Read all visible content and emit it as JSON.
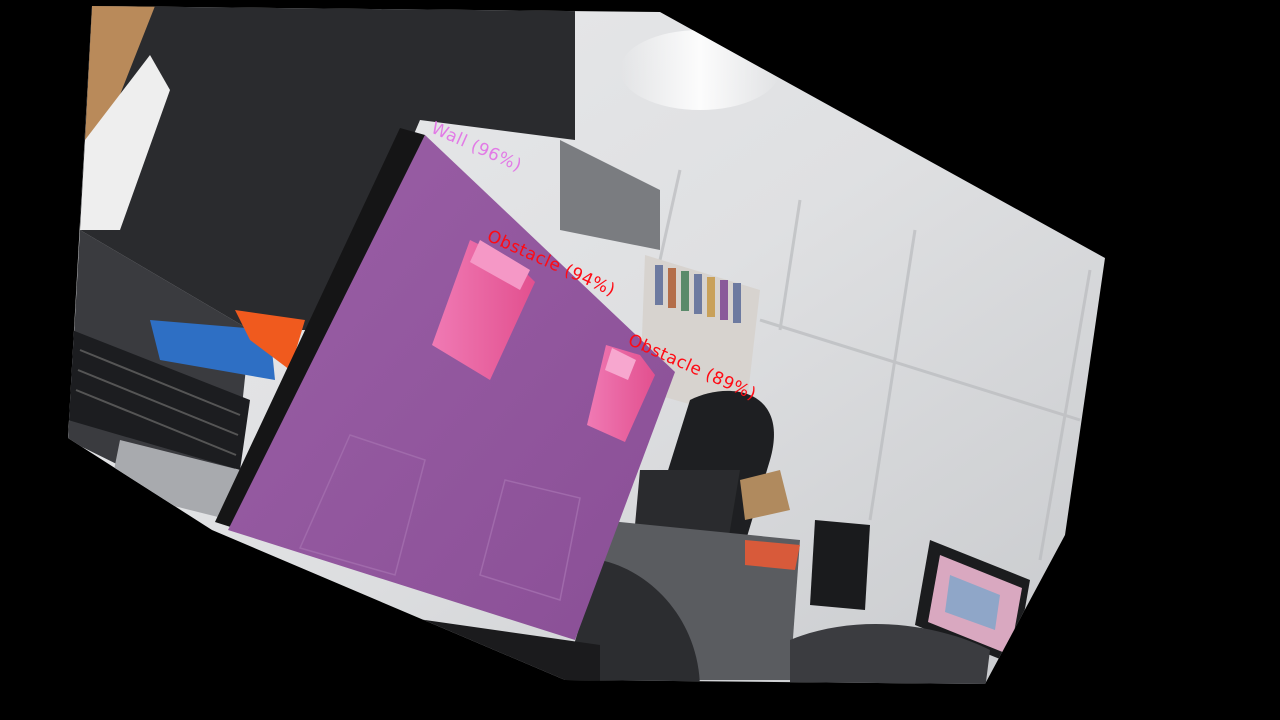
{
  "image": {
    "description_free": true,
    "overlay_colors": {
      "wall": "#e27ae6",
      "obstacle": "#ff0a14"
    }
  },
  "detections": [
    {
      "label": "Wall (96%)",
      "class": "wall"
    },
    {
      "label": "Obstacle (94%)",
      "class": "obstacle"
    },
    {
      "label": "Obstacle (89%)",
      "class": "obstacle"
    }
  ]
}
